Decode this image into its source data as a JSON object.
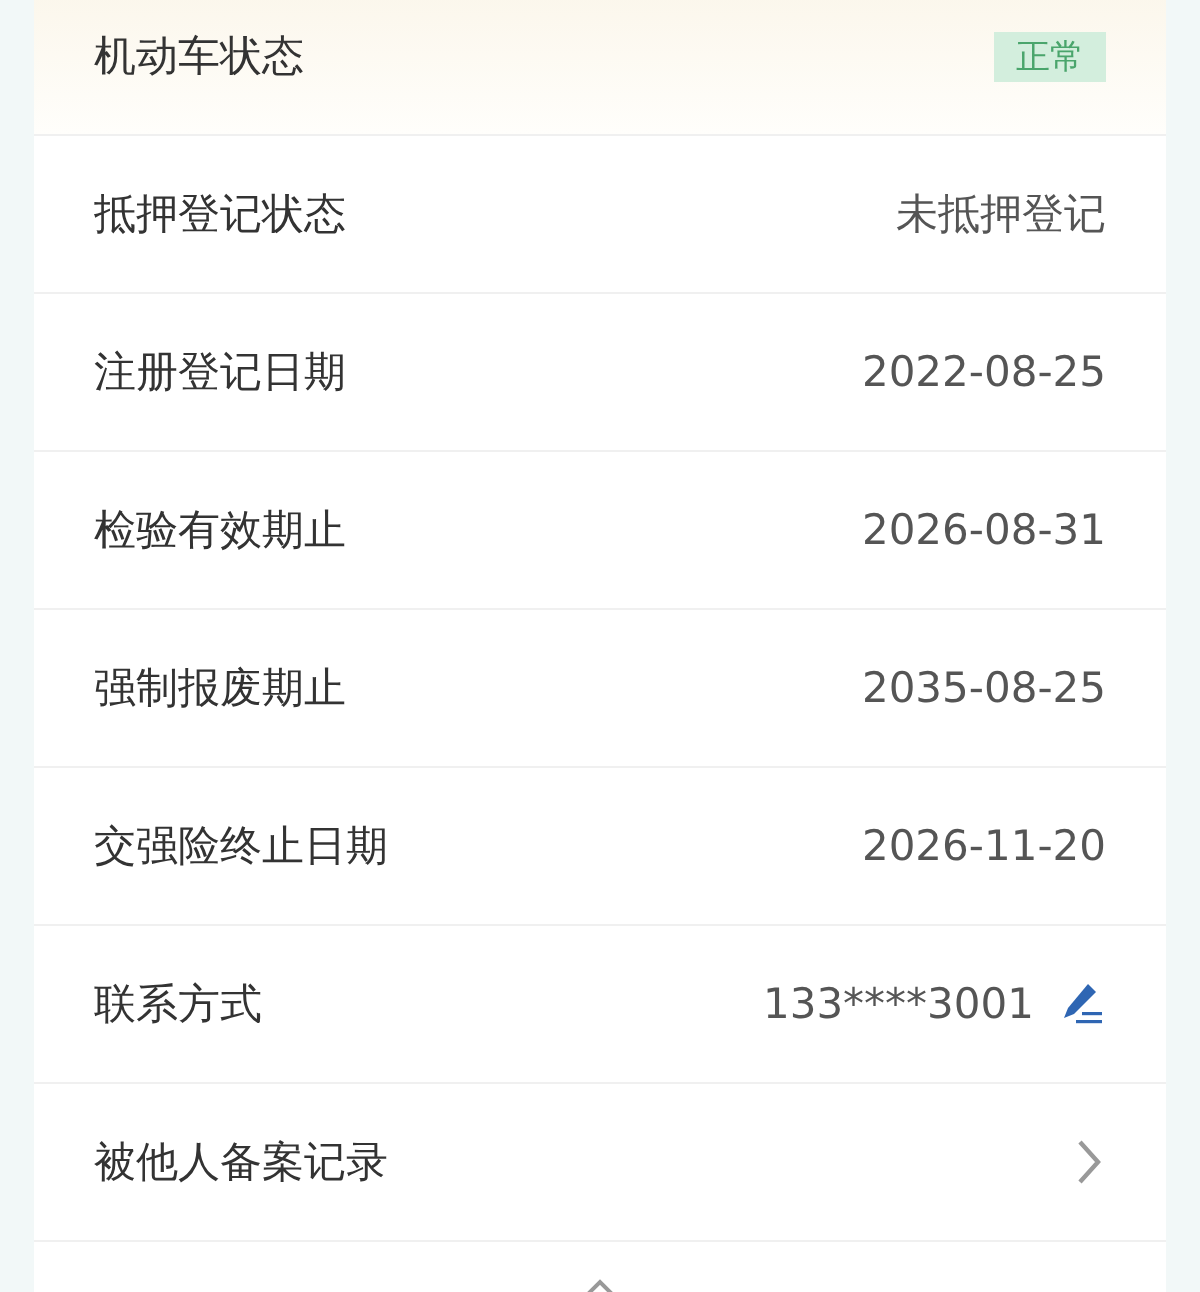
{
  "rows": [
    {
      "kind": "badge",
      "label": "机动车状态",
      "value": "正常"
    },
    {
      "kind": "text",
      "label": "抵押登记状态",
      "value": "未抵押登记"
    },
    {
      "kind": "text",
      "label": "注册登记日期",
      "value": "2022-08-25"
    },
    {
      "kind": "text",
      "label": "检验有效期止",
      "value": "2026-08-31"
    },
    {
      "kind": "text",
      "label": "强制报废期止",
      "value": "2035-08-25"
    },
    {
      "kind": "text",
      "label": "交强险终止日期",
      "value": "2026-11-20"
    },
    {
      "kind": "editable",
      "label": "联系方式",
      "value": "133****3001"
    },
    {
      "kind": "link",
      "label": "被他人备案记录"
    }
  ]
}
